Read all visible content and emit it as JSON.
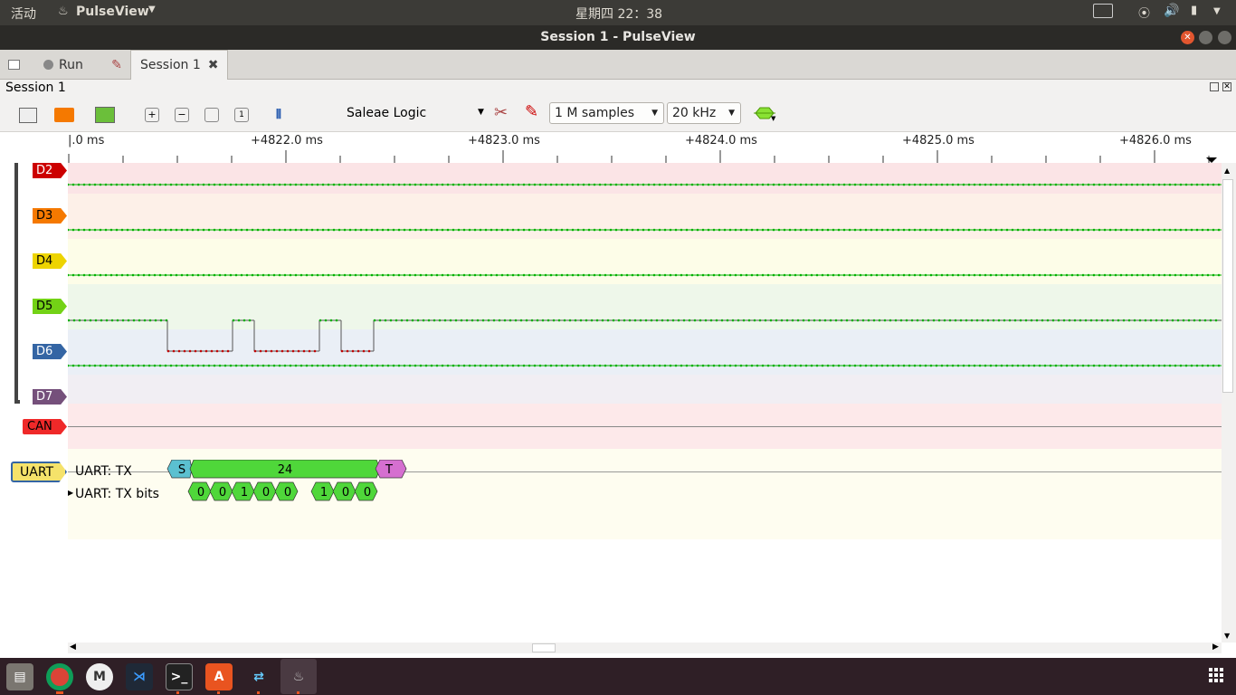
{
  "topbar": {
    "activities": "活动",
    "app_name": "PulseView",
    "clock": "星期四 22：38"
  },
  "window": {
    "title": "Session 1 - PulseView"
  },
  "tabs": {
    "run_label": "Run",
    "session_tab": "Session 1"
  },
  "session": {
    "header": "Session 1"
  },
  "toolbar": {
    "device": "Saleae Logic",
    "samples": "1 M samples",
    "rate": "20 kHz"
  },
  "ruler": {
    "labels": [
      "|.0 ms",
      "+4822.0 ms",
      "+4823.0 ms",
      "+4824.0 ms",
      "+4825.0 ms",
      "+4826.0 ms"
    ]
  },
  "channels": [
    {
      "name": "D2",
      "color": "#cc0000",
      "text": "#ffffff",
      "band": "#fbe4e6"
    },
    {
      "name": "D3",
      "color": "#f57900",
      "text": "#000000",
      "band": "#fdf0e8"
    },
    {
      "name": "D4",
      "color": "#edd400",
      "text": "#000000",
      "band": "#fdfde8"
    },
    {
      "name": "D5",
      "color": "#73d216",
      "text": "#000000",
      "band": "#eef7ea"
    },
    {
      "name": "D6",
      "color": "#3465a4",
      "text": "#ffffff",
      "band": "#eaeff6"
    },
    {
      "name": "D7",
      "color": "#75507b",
      "text": "#ffffff",
      "band": "#f1eef3"
    }
  ],
  "can": {
    "name": "CAN",
    "color": "#ef2929",
    "band": "#fde9ea"
  },
  "decoder": {
    "name": "UART",
    "row1_label": "UART: TX",
    "row2_label": "UART: TX bits",
    "start": "S",
    "value": "24",
    "stop": "T",
    "bits": [
      "0",
      "0",
      "1",
      "0",
      "0",
      "1",
      "0",
      "0"
    ]
  },
  "colors": {
    "trace": "#00b000",
    "low": "#c00000",
    "decoder_green": "#4fd73a",
    "start_cyan": "#5bc0d0",
    "stop_purple": "#d56fd0"
  }
}
